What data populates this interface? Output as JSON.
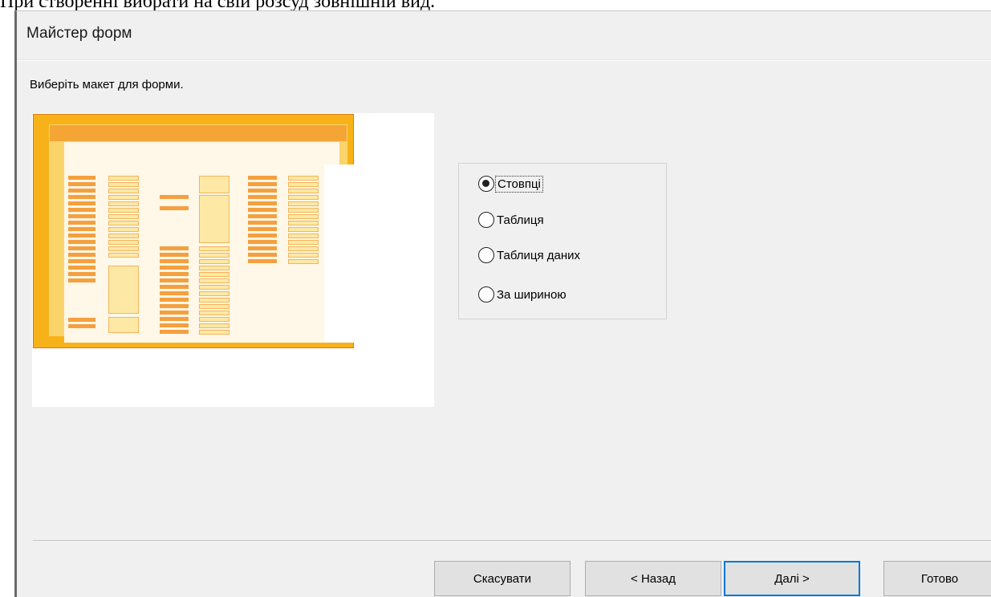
{
  "document": {
    "caption": "При створенні вибрати на свій розсуд зовнішній вид."
  },
  "dialog": {
    "title": "Майстер форм",
    "prompt": "Виберіть макет для форми."
  },
  "layout_options": [
    {
      "label": "Стовпці",
      "selected": true
    },
    {
      "label": "Таблиця",
      "selected": false
    },
    {
      "label": "Таблиця даних",
      "selected": false
    },
    {
      "label": "За шириною",
      "selected": false
    }
  ],
  "buttons": {
    "cancel": "Скасувати",
    "back": "< Назад",
    "next": "Далі >",
    "finish": "Готово"
  },
  "colors": {
    "dialog_bg": "#f0f0f0",
    "preview_orange": "#f8b219",
    "default_button_border": "#0078d7"
  }
}
